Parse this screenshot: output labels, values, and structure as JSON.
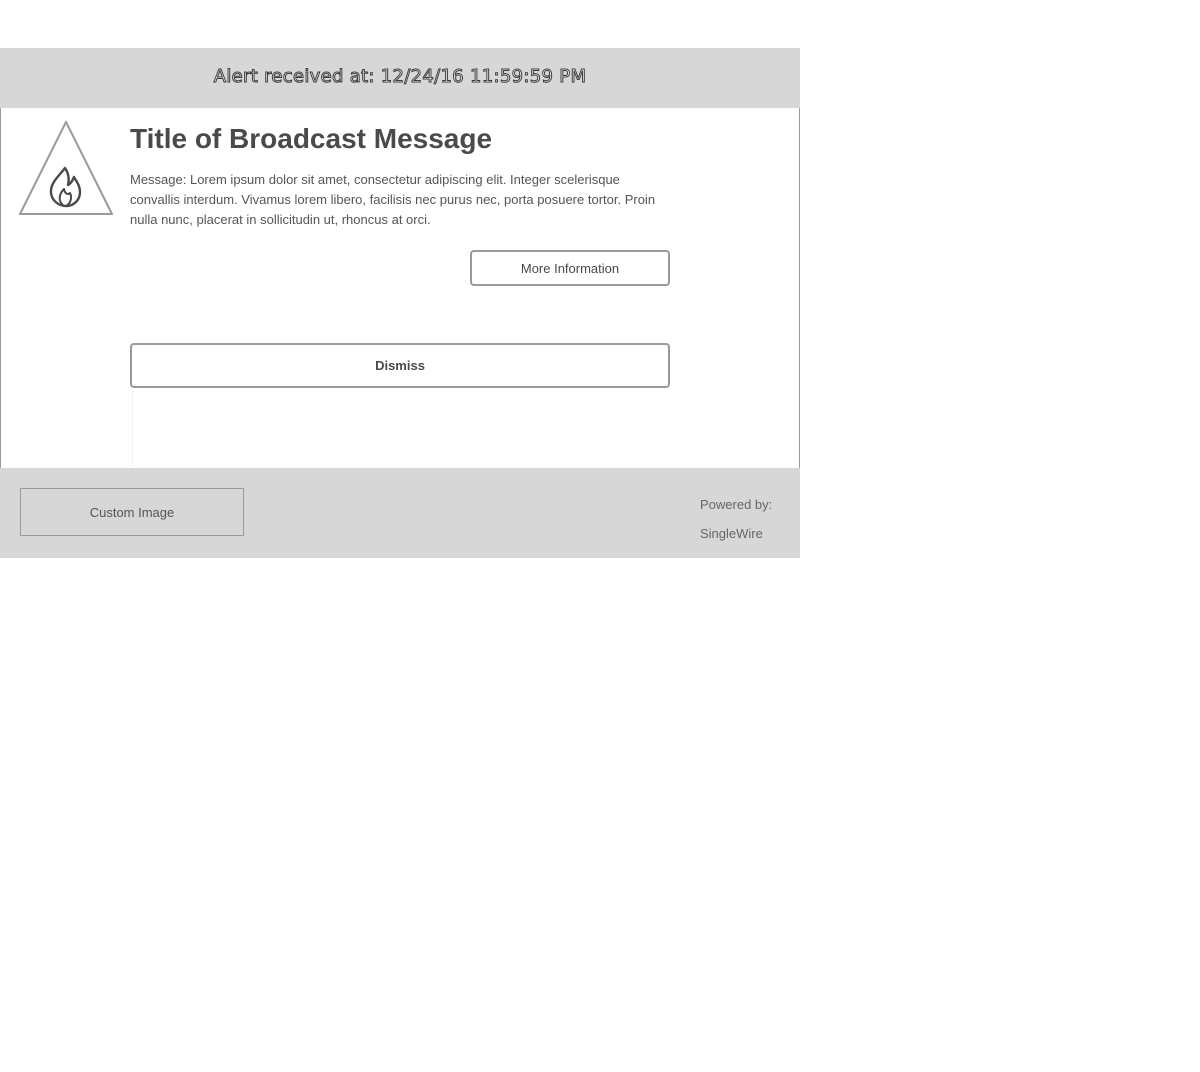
{
  "header": {
    "alert_received": "Alert received at: 12/24/16 11:59:59 PM"
  },
  "alert": {
    "icon": "fire-warning-icon",
    "title": "Title of Broadcast Message",
    "message": "Message: Lorem ipsum dolor sit amet, consectetur adipiscing elit. Integer scelerisque convallis interdum. Vivamus lorem libero, facilisis nec purus nec, porta posuere tortor. Proin nulla nunc, placerat in sollicitudin ut, rhoncus at orci."
  },
  "buttons": {
    "more_information": "More Information",
    "dismiss": "Dismiss"
  },
  "footer": {
    "custom_image": "Custom Image",
    "powered_by_label": "Powered by:",
    "powered_by_name": "SingleWire"
  },
  "colors": {
    "bar_background": "#d7d7d7",
    "border": "#9a9a9a",
    "text": "#4a4a4a"
  }
}
